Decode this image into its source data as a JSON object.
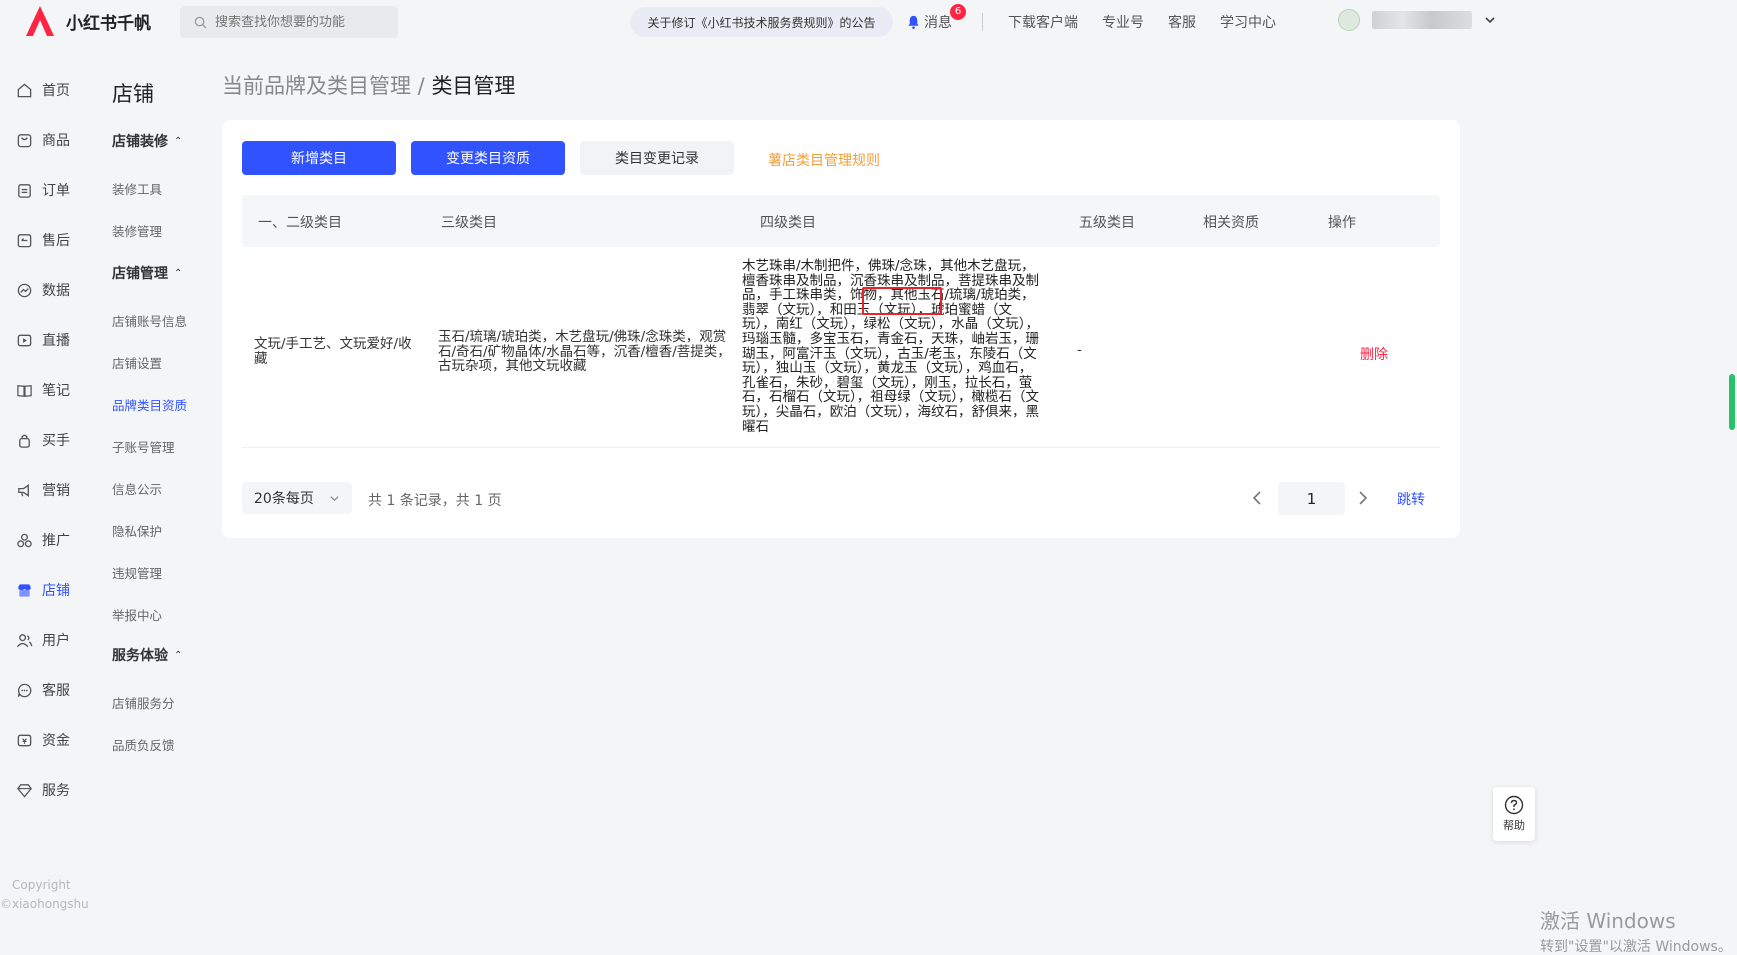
{
  "brand": {
    "name": "小红书千帆",
    "color": "#ff2442"
  },
  "search": {
    "placeholder": "搜索查找你想要的功能"
  },
  "notice": "关于修订《小红书技术服务费规则》的公告",
  "messages": {
    "label": "消息",
    "count": "6"
  },
  "top_links": [
    "下载客户端",
    "专业号",
    "客服",
    "学习中心"
  ],
  "nav": [
    {
      "label": "首页",
      "icon": "home-icon"
    },
    {
      "label": "商品",
      "icon": "product-icon"
    },
    {
      "label": "订单",
      "icon": "order-icon"
    },
    {
      "label": "售后",
      "icon": "aftersale-icon"
    },
    {
      "label": "数据",
      "icon": "data-icon"
    },
    {
      "label": "直播",
      "icon": "live-icon"
    },
    {
      "label": "笔记",
      "icon": "notes-icon"
    },
    {
      "label": "买手",
      "icon": "buyer-icon"
    },
    {
      "label": "营销",
      "icon": "marketing-icon"
    },
    {
      "label": "推广",
      "icon": "promotion-icon"
    },
    {
      "label": "店铺",
      "icon": "store-icon"
    },
    {
      "label": "用户",
      "icon": "users-icon"
    },
    {
      "label": "客服",
      "icon": "service-icon"
    },
    {
      "label": "资金",
      "icon": "funds-icon"
    },
    {
      "label": "服务",
      "icon": "diamond-icon"
    }
  ],
  "copyright": [
    "Copyright",
    "©xiaohongshu"
  ],
  "subnav": {
    "title": "店铺",
    "groups": [
      {
        "label": "店铺装修",
        "items": [
          "装修工具",
          "装修管理"
        ]
      },
      {
        "label": "店铺管理",
        "items": [
          "店铺账号信息",
          "店铺设置",
          "品牌类目资质",
          "子账号管理",
          "信息公示",
          "隐私保护",
          "违规管理",
          "举报中心"
        ]
      },
      {
        "label": "服务体验",
        "items": [
          "店铺服务分",
          "品质负反馈"
        ]
      }
    ]
  },
  "breadcrumb": {
    "parent": "当前品牌及类目管理",
    "separator": " / ",
    "current": "类目管理"
  },
  "toolbar": {
    "add": "新增类目",
    "change": "变更类目资质",
    "history": "类目变更记录",
    "rules": "薯店类目管理规则"
  },
  "table": {
    "headers": [
      "一、二级类目",
      "三级类目",
      "四级类目",
      "五级类目",
      "相关资质",
      "操作"
    ],
    "rows": [
      {
        "l12": "文玩/手工艺、文玩爱好/收藏",
        "l3": "玉石/琉璃/琥珀类，木艺盘玩/佛珠/念珠类，观赏石/奇石/矿物晶体/水晶石等，沉香/檀香/菩提类，古玩杂项，其他文玩收藏",
        "l4": "木艺珠串/木制把件，佛珠/念珠，其他木艺盘玩，檀香珠串及制品，沉香珠串及制品，菩提珠串及制品，手工珠串类，饰物，其他玉石/琉璃/琥珀类，翡翠（文玩），和田玉（文玩），琥珀蜜蜡（文玩），南红（文玩），绿松（文玩），水晶（文玩），玛瑙玉髓，多宝玉石，青金石，天珠，岫岩玉，珊瑚玉，阿富汗玉（文玩），古玉/老玉，东陵石（文玩），独山玉（文玩），黄龙玉（文玩），鸡血石，孔雀石，朱砂，碧玺（文玩），刚玉，拉长石，萤石，石榴石（文玩），祖母绿（文玩），橄榄石（文玩），尖晶石，欧泊（文玩），海纹石，舒俱来，黑曜石",
        "l5": "-",
        "qualification": "",
        "action": "删除"
      }
    ]
  },
  "pagination": {
    "page_size": "20条每页",
    "summary": "共 1 条记录，共 1 页",
    "current_page": "1",
    "jump": "跳转"
  },
  "help": "帮助",
  "watermark": {
    "line1": "激活 Windows",
    "line2": "转到\"设置\"以激活 Windows。"
  },
  "colors": {
    "primary": "#3152ff",
    "danger": "#ff2442",
    "orange_link": "#f0a03a",
    "highlight": "#e8232e"
  }
}
